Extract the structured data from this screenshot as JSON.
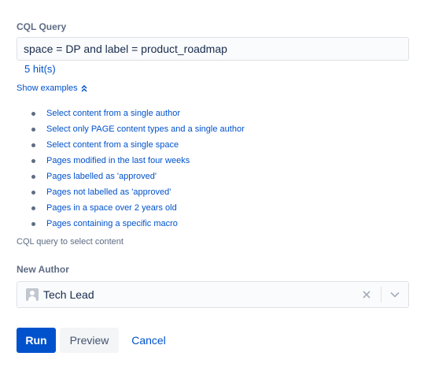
{
  "cql": {
    "label": "CQL Query",
    "query_value": "space = DP and label = product_roadmap",
    "hits": "5 hit(s)",
    "show_examples": "Show examples",
    "examples": [
      "Select content from a single author",
      "Select only PAGE content types and a single author",
      "Select content from a single space",
      "Pages modified in the last four weeks",
      "Pages labelled as 'approved'",
      "Pages not labelled as 'approved'",
      "Pages in a space over 2 years old",
      "Pages containing a specific macro"
    ],
    "helper_text": "CQL query to select content"
  },
  "author": {
    "label": "New Author",
    "selected_value": "Tech Lead",
    "avatar_icon": "user-avatar-icon",
    "clear_icon": "close-icon",
    "dropdown_icon": "chevron-down-icon"
  },
  "actions": {
    "run_label": "Run",
    "preview_label": "Preview",
    "cancel_label": "Cancel"
  },
  "colors": {
    "primary": "#0052cc",
    "link": "#0052cc",
    "text": "#172b4d",
    "subtle_text": "#5e6c84",
    "field_border": "#dfe1e6",
    "field_bg": "#fafbfc",
    "secondary_button_bg": "#f4f5f7"
  }
}
